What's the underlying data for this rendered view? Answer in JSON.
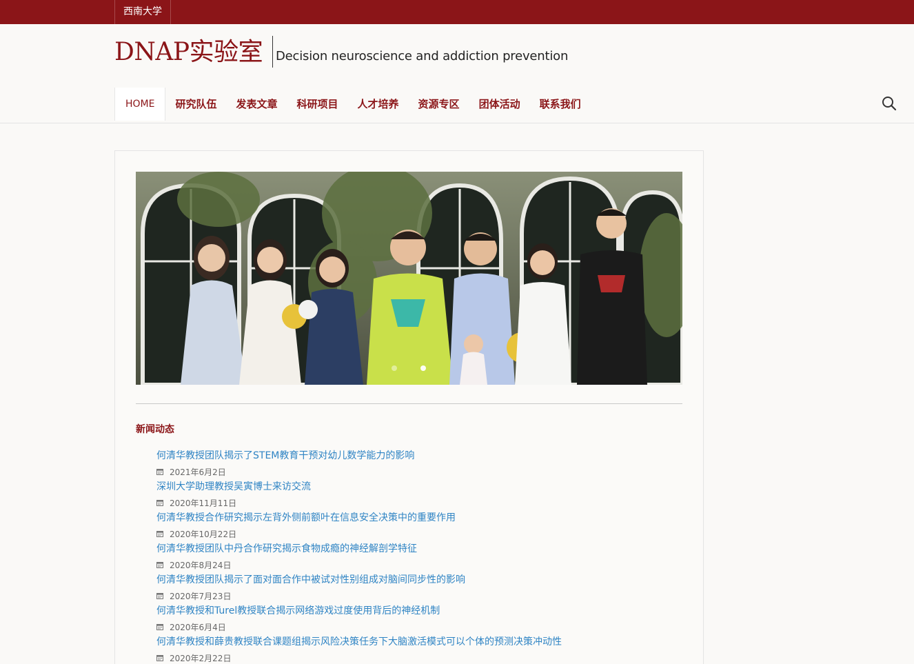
{
  "topbar": {
    "university_link": "西南大学"
  },
  "header": {
    "site_title": "DNAP实验室",
    "tagline": "Decision neuroscience and addiction prevention"
  },
  "nav": {
    "items": [
      {
        "label": "HOME",
        "active": true
      },
      {
        "label": "研究队伍"
      },
      {
        "label": "发表文章"
      },
      {
        "label": "科研项目"
      },
      {
        "label": "人才培养"
      },
      {
        "label": "资源专区"
      },
      {
        "label": "团体活动"
      },
      {
        "label": "联系我们"
      }
    ],
    "search_icon": "search-icon"
  },
  "slider": {
    "slide_count": 2,
    "active_slide": 2
  },
  "news": {
    "section_title": "新闻动态",
    "items": [
      {
        "title": "何清华教授团队揭示了STEM教育干预对幼儿数学能力的影响",
        "date": "2021年6月2日"
      },
      {
        "title": "深圳大学助理教授吴寅博士来访交流",
        "date": "2020年11月11日"
      },
      {
        "title": "何清华教授合作研究揭示左背外侧前额叶在信息安全决策中的重要作用",
        "date": "2020年10月22日"
      },
      {
        "title": "何清华教授团队中丹合作研究揭示食物成瘾的神经解剖学特征",
        "date": "2020年8月24日"
      },
      {
        "title": "何清华教授团队揭示了面对面合作中被试对性别组成对脑间同步性的影响",
        "date": "2020年7月23日"
      },
      {
        "title": "何清华教授和Turel教授联合揭示网络游戏过度使用背后的神经机制",
        "date": "2020年6月4日"
      },
      {
        "title": "何清华教授和薛贵教授联合课题组揭示风险决策任务下大脑激活模式可以个体的预测决策冲动性",
        "date": "2020年2月22日"
      }
    ]
  },
  "colors": {
    "brand": "#8b1518",
    "link": "#2f84c4",
    "background": "#faf9f7"
  }
}
